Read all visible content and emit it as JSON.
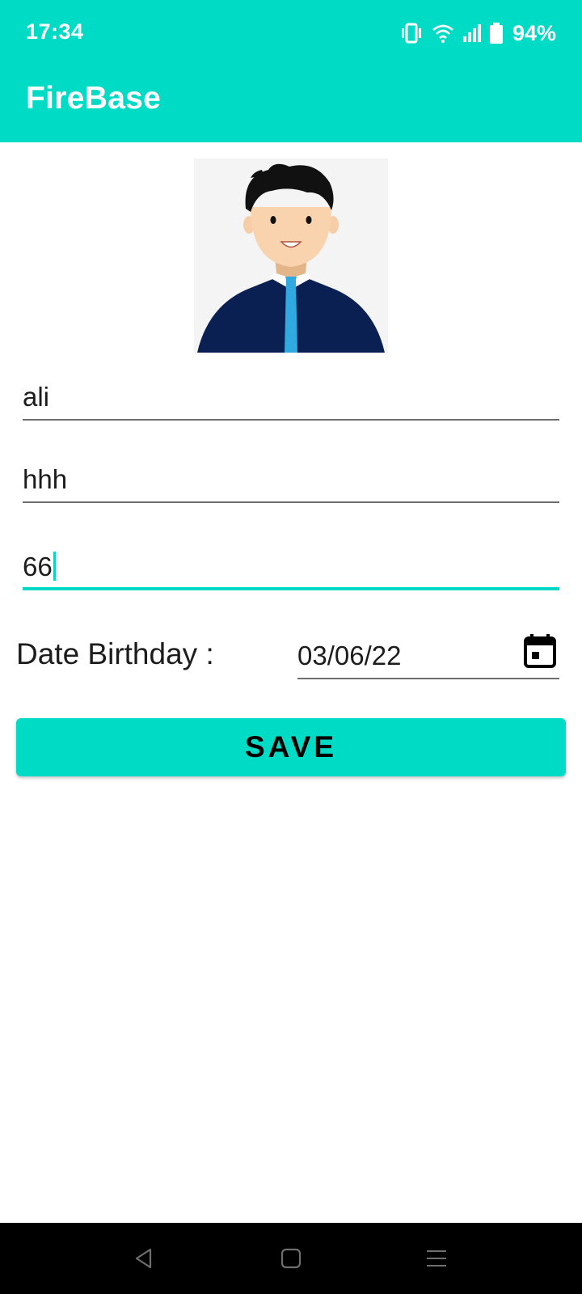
{
  "status_bar": {
    "time": "17:34",
    "battery": "94%",
    "icons": [
      "vibrate-icon",
      "wifi-icon",
      "signal-icon",
      "battery-icon"
    ]
  },
  "app_bar": {
    "title": "FireBase"
  },
  "avatar": {
    "icon": "user-avatar-illustration"
  },
  "form": {
    "name_value": "ali",
    "second_value": "hhh",
    "third_value": "66",
    "date_label": "Date Birthday :",
    "date_value": "03/06/22",
    "date_icon": "calendar-icon",
    "save_label": "SAVE"
  },
  "nav_bar": {
    "icons": [
      "back-icon",
      "home-icon",
      "recents-icon"
    ]
  },
  "colors": {
    "accent": "#00dbc6",
    "focus_line": "#00d7c4",
    "nav_background": "#000000"
  }
}
